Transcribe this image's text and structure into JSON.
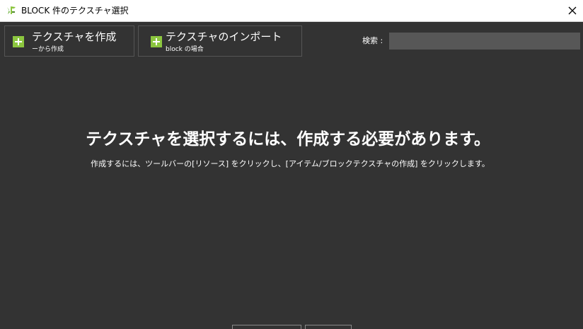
{
  "titlebar": {
    "title": "BLOCK 件のテクスチャ選択",
    "app_icon": "app-logo-icon",
    "close_icon": "close-icon"
  },
  "toolbar": {
    "create_texture": {
      "label": "テクスチャを作成",
      "sublabel": "ーから作成",
      "icon": "plus-icon"
    },
    "import_texture": {
      "label": "テクスチャのインポート",
      "sublabel": "block の場合",
      "icon": "plus-icon"
    }
  },
  "search": {
    "label": "検索 :",
    "value": "",
    "placeholder": ""
  },
  "empty_state": {
    "heading": "テクスチャを選択するには、作成する必要があります。",
    "hint": "作成するには、ツールバーの[リソース] をクリックし、[アイテム/ブロックテクスチャの作成] をクリックします。"
  },
  "colors": {
    "background": "#333333",
    "accent_green": "#8cc63f",
    "search_bg": "#575757",
    "titlebar_bg": "#ffffff"
  }
}
